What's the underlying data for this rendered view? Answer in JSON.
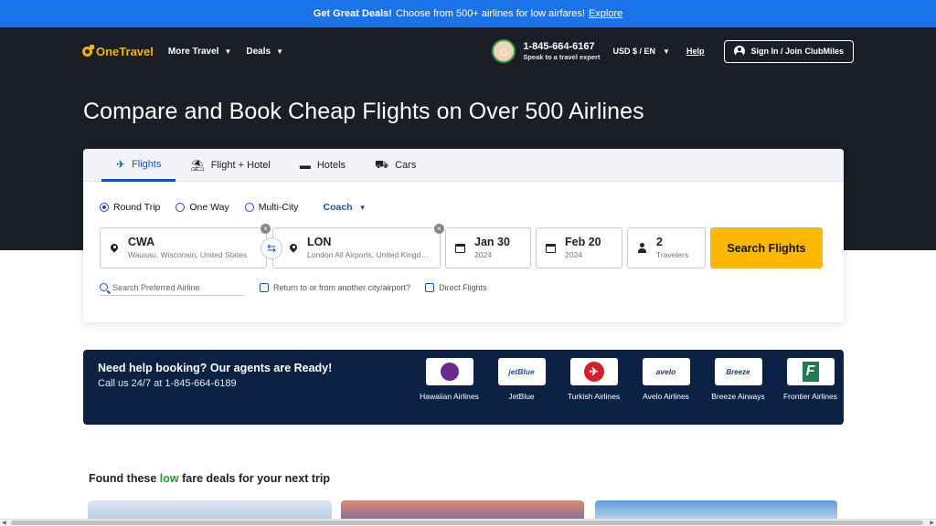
{
  "promo": {
    "bold": "Get Great Deals!",
    "text": "Choose from 500+ airlines for low airfares!",
    "link": "Explore"
  },
  "nav": {
    "logo": "OneTravel",
    "more_travel": "More Travel",
    "deals": "Deals",
    "phone_number": "1-845-664-6167",
    "phone_sub": "Speak to a travel expert",
    "currency": "USD $ / EN",
    "help": "Help",
    "signin_prefix": "Sign In / Join",
    "signin_brand": "ClubMiles"
  },
  "hero": {
    "title": "Compare and Book Cheap Flights on Over 500 Airlines"
  },
  "search": {
    "tabs": [
      {
        "label": "Flights",
        "icon": "plane-icon"
      },
      {
        "label": "Flight + Hotel",
        "icon": "beach-icon"
      },
      {
        "label": "Hotels",
        "icon": "bed-icon"
      },
      {
        "label": "Cars",
        "icon": "car-icon"
      }
    ],
    "trip_types": [
      "Round Trip",
      "One Way",
      "Multi-City"
    ],
    "cabin": "Coach",
    "origin_code": "CWA",
    "origin_name": "Wausau, Wisconsin, United States",
    "dest_code": "LON",
    "dest_name": "London All Airports, United Kingdom",
    "depart_date": "Jan 30",
    "depart_year": "2024",
    "return_date": "Feb 20",
    "return_year": "2024",
    "travelers_count": "2",
    "travelers_label": "Travelers",
    "search_button": "Search Flights",
    "airline_placeholder": "Search Preferred Airline",
    "return_other_city": "Return to or from another city/airport?",
    "direct_flights": "Direct Flights"
  },
  "help_banner": {
    "title": "Need help booking? Our agents are Ready!",
    "subtitle": "Call us 24/7 at 1-845-664-6189",
    "airlines": [
      {
        "name": "Hawaiian Airlines"
      },
      {
        "name": "JetBlue",
        "logo": "jetBlue"
      },
      {
        "name": "Turkish Airlines"
      },
      {
        "name": "Avelo Airlines",
        "logo": "avelo"
      },
      {
        "name": "Breeze Airways",
        "logo": "Breeze"
      },
      {
        "name": "Frontier Airlines"
      }
    ]
  },
  "deals": {
    "prefix": "Found these",
    "highlight": "low",
    "suffix": "fare deals for your next trip"
  },
  "colors": {
    "brand_blue": "#1a73e8",
    "nav_dark": "#1b1d27",
    "accent_yellow": "#fcb900",
    "link_blue": "#1a4fc4",
    "banner_navy": "#0b2244",
    "deal_green": "#1f9d3a"
  }
}
